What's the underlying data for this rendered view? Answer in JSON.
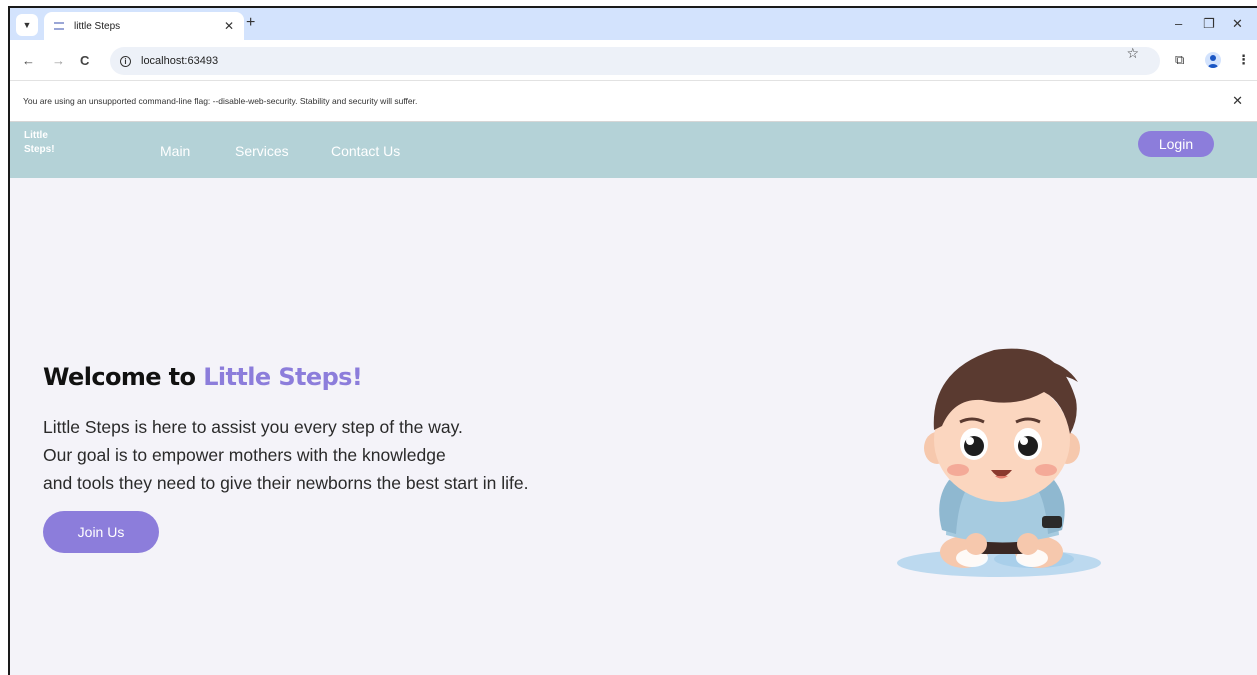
{
  "browser": {
    "tab_title": "little Steps",
    "tab_close": "✕",
    "new_tab": "+",
    "url": "localhost:63493",
    "infobar_text": "You are using an unsupported command-line flag: --disable-web-security. Stability and security will suffer.",
    "infobar_close": "✕",
    "window_controls": {
      "minimize": "–",
      "restore": "❐",
      "close": "✕"
    },
    "nav": {
      "back": "←",
      "forward": "→",
      "reload": "C"
    },
    "icons": {
      "star": "☆",
      "extensions": "⧉",
      "menu": "⋮"
    }
  },
  "site": {
    "logo": "Little Steps!",
    "nav_links": [
      "Main",
      "Services",
      "Contact Us"
    ],
    "login_label": "Login"
  },
  "hero": {
    "title_prefix": "Welcome to ",
    "title_accent": "Little Steps!",
    "description_lines": [
      "Little Steps is here to assist you every step of the way.",
      "Our goal is to empower mothers with the knowledge",
      "and tools they need to give their newborns the best start in life."
    ],
    "cta_label": "Join Us",
    "illustration": "baby-illustration"
  },
  "colors": {
    "accent": "#8c7ddb",
    "nav_bg": "#b4d2d7",
    "page_bg": "#f4f3f9",
    "tab_strip": "#d3e3fd"
  }
}
